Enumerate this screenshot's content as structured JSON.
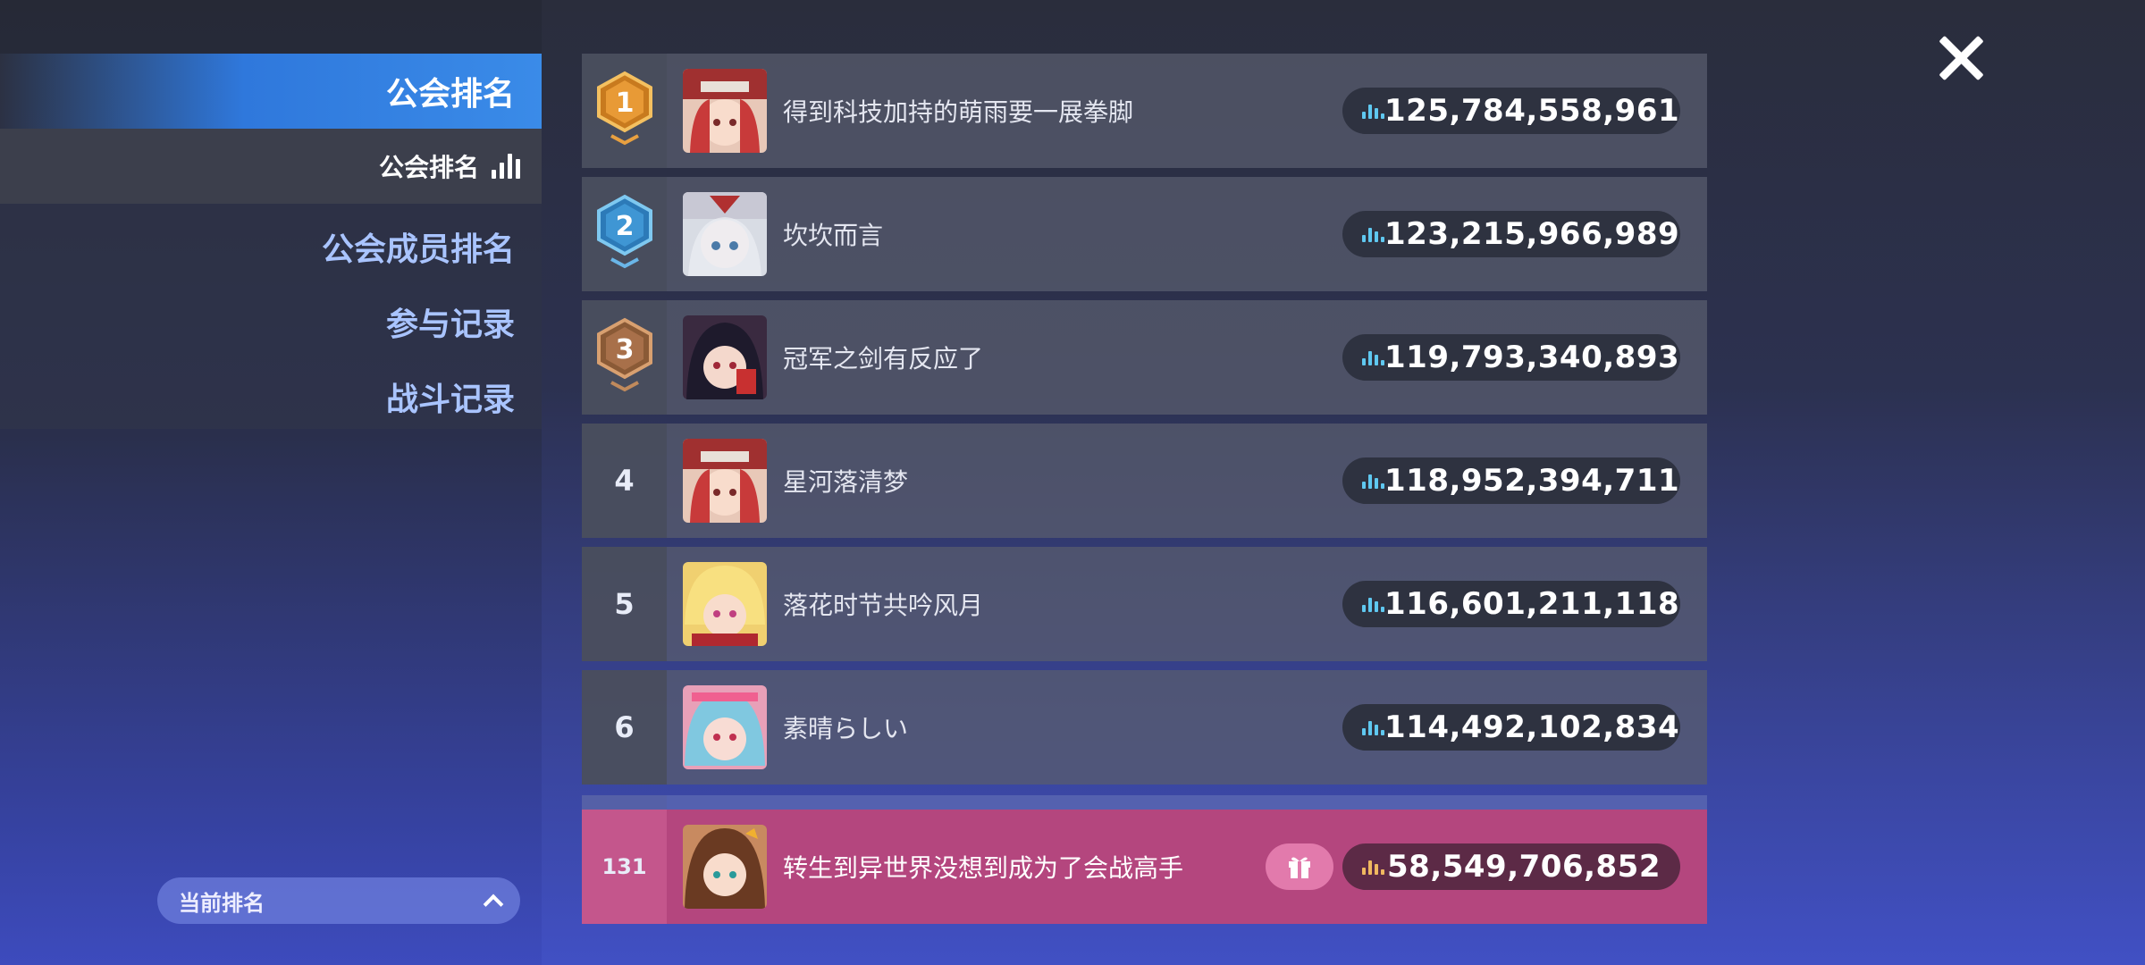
{
  "sidebar": {
    "title": "公会排名",
    "sub_item": "公会排名",
    "items": [
      "公会成员排名",
      "参与记录",
      "战斗记录"
    ],
    "current_rank_label": "当前排名"
  },
  "rows": [
    {
      "rank": "1",
      "name": "得到科技加持的萌雨要一展拳脚",
      "score": "125,784,558,961",
      "medal": "gold"
    },
    {
      "rank": "2",
      "name": "坎坎而言",
      "score": "123,215,966,989",
      "medal": "blue"
    },
    {
      "rank": "3",
      "name": "冠军之剑有反应了",
      "score": "119,793,340,893",
      "medal": "bronze"
    },
    {
      "rank": "4",
      "name": "星河落清梦",
      "score": "118,952,394,711"
    },
    {
      "rank": "5",
      "name": "落花时节共吟风月",
      "score": "116,601,211,118"
    },
    {
      "rank": "6",
      "name": "素晴らしい",
      "score": "114,492,102,834"
    }
  ],
  "my_row": {
    "rank": "131",
    "name": "转生到异世界没想到成为了会战高手",
    "score": "58,549,706,852"
  },
  "colors": {
    "score_icon": "#5fc8f0",
    "my_score_icon": "#f0b860",
    "accent": "#2f78dc",
    "highlight": "#b4467e"
  }
}
